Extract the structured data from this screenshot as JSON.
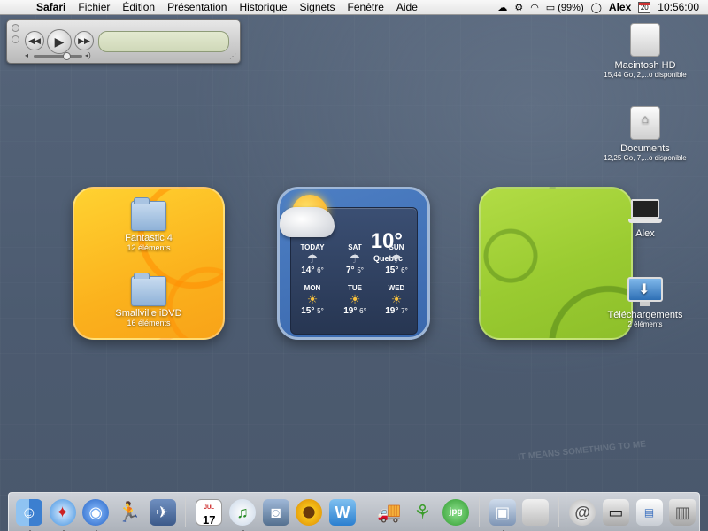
{
  "menubar": {
    "apple": "",
    "app": "Safari",
    "items": [
      "Fichier",
      "Édition",
      "Présentation",
      "Historique",
      "Signets",
      "Fenêtre",
      "Aide"
    ],
    "battery": "(99%)",
    "user": "Alex",
    "calendar_day": "20",
    "clock": "10:56:00"
  },
  "player": {
    "lcd_logo": ""
  },
  "orange_widget": {
    "folders": [
      {
        "name": "Fantastic 4",
        "sub": "12 éléments"
      },
      {
        "name": "Smallville iDVD",
        "sub": "16 éléments"
      }
    ]
  },
  "weather": {
    "temp": "10°",
    "city": "Quebec",
    "row1": [
      {
        "day": "TODAY",
        "hi": "14°",
        "lo": "6°",
        "cond": "rain"
      },
      {
        "day": "SAT",
        "hi": "7°",
        "lo": "5°",
        "cond": "rain"
      },
      {
        "day": "SUN",
        "hi": "15°",
        "lo": "6°",
        "cond": "rain"
      }
    ],
    "row2": [
      {
        "day": "MON",
        "hi": "15°",
        "lo": "5°",
        "cond": "sunny"
      },
      {
        "day": "TUE",
        "hi": "19°",
        "lo": "6°",
        "cond": "sunny"
      },
      {
        "day": "WED",
        "hi": "19°",
        "lo": "7°",
        "cond": "sunny"
      }
    ]
  },
  "desktop": {
    "hd": {
      "name": "Macintosh HD",
      "sub": "15,44 Go, 2,...o disponible"
    },
    "docs": {
      "name": "Documents",
      "sub": "12,25 Go, 7,...o disponible"
    },
    "alex": {
      "name": "Alex"
    },
    "downloads": {
      "name": "Téléchargements",
      "sub": "2 éléments"
    }
  },
  "overlay": "IT MEANS SOMETHING TO ME",
  "dock": {
    "calendar_month": "JUL",
    "calendar_day": "17",
    "jpg_label": "jpg"
  }
}
